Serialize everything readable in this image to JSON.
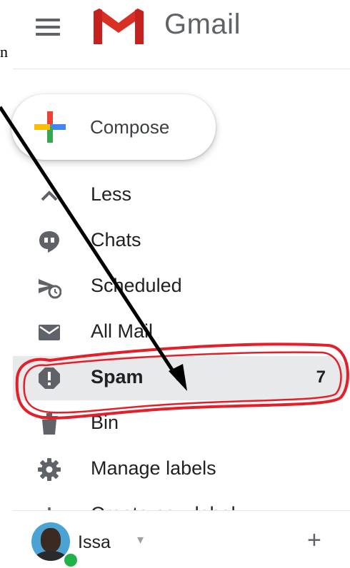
{
  "edge_fragment": "n",
  "header": {
    "menu_icon": "hamburger-menu-icon",
    "logo_icon": "gmail-logo-icon",
    "app_name": "Gmail"
  },
  "compose": {
    "label": "Compose",
    "icon": "compose-plus-icon",
    "colors": [
      "#ea4335",
      "#4285f4",
      "#34a853",
      "#fbbc04"
    ]
  },
  "nav": {
    "items": [
      {
        "label": "Less",
        "icon": "chevron-up-icon"
      },
      {
        "label": "Chats",
        "icon": "chats-icon"
      },
      {
        "label": "Scheduled",
        "icon": "scheduled-send-icon"
      },
      {
        "label": "All Mail",
        "icon": "all-mail-icon"
      },
      {
        "label": "Spam",
        "icon": "spam-icon",
        "count": "7",
        "active": true
      },
      {
        "label": "Bin",
        "icon": "bin-icon"
      },
      {
        "label": "Manage labels",
        "icon": "gear-icon"
      },
      {
        "label": "Create new label",
        "icon": "plus-icon"
      }
    ]
  },
  "footer": {
    "user_name": "Issa",
    "caret": "▾",
    "add_label": "+",
    "presence_color": "#20b14a"
  },
  "annotation": {
    "highlight_color": "#e3202a",
    "arrow_color": "#000000"
  }
}
